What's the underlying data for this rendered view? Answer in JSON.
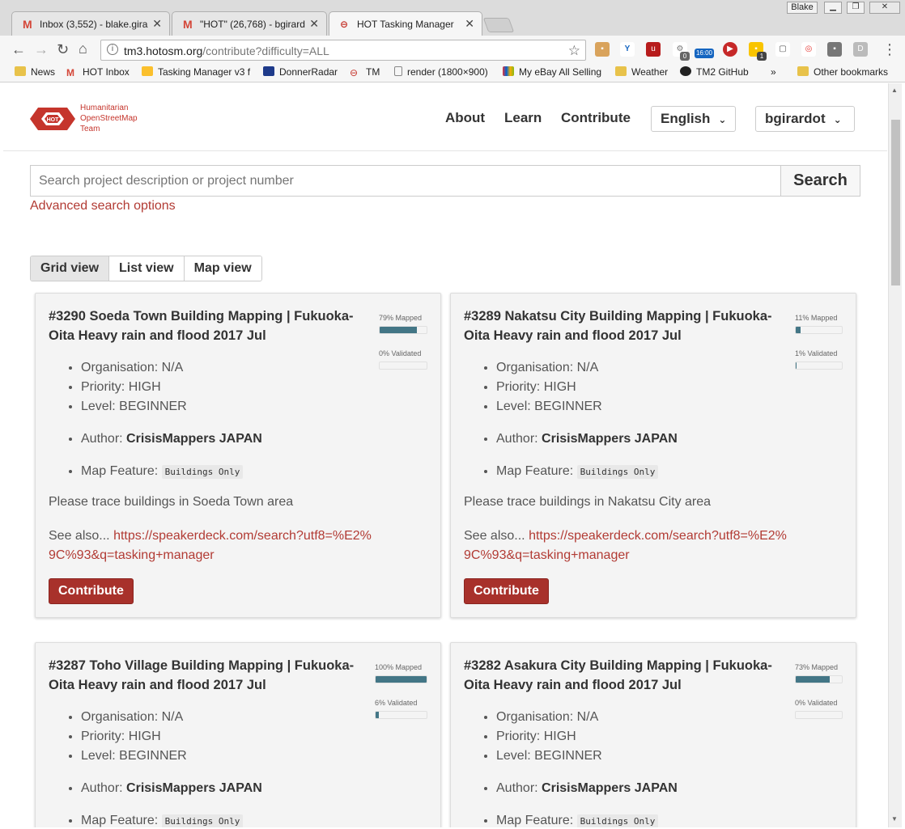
{
  "browser": {
    "window_user": "Blake",
    "tabs": [
      {
        "title": "Inbox (3,552) - blake.gira",
        "icon": "gmail-icon"
      },
      {
        "title": "\"HOT\" (26,768) - bgirard",
        "icon": "gmail-icon"
      },
      {
        "title": "HOT Tasking Manager",
        "icon": "hot-icon"
      }
    ],
    "url_host": "tm3.hotosm.org",
    "url_path": "/contribute?difficulty=ALL",
    "ext_badges": {
      "time": "16:00",
      "count0": "0",
      "count1": "1",
      "d": "D"
    },
    "bookmarks": [
      "News",
      "HOT Inbox",
      "Tasking Manager v3 f",
      "DonnerRadar",
      "TM",
      "render (1800×900)",
      "My eBay All Selling",
      "Weather",
      "TM2 GitHub"
    ],
    "bookmarks_more": "»",
    "other_bookmarks": "Other bookmarks"
  },
  "header": {
    "logo_lines": [
      "Humanitarian",
      "OpenStreetMap",
      "Team"
    ],
    "logo_badge": "HOT",
    "nav": [
      "About",
      "Learn",
      "Contribute"
    ],
    "language": "English",
    "user": "bgirardot"
  },
  "search": {
    "placeholder": "Search project description or project number",
    "button": "Search",
    "advanced": "Advanced search options"
  },
  "views": [
    "Grid view",
    "List view",
    "Map view"
  ],
  "projects": [
    {
      "title": "#3290 Soeda Town Building Mapping | Fukuoka-Oita Heavy rain and flood 2017 Jul",
      "mapped_label": "79% Mapped",
      "mapped": 0.79,
      "validated_label": "0% Validated",
      "validated": 0.0,
      "org_label": "Organisation:",
      "organisation": "N/A",
      "priority_label": "Priority:",
      "priority": "HIGH",
      "level_label": "Level:",
      "level": "BEGINNER",
      "author_label": "Author:",
      "author": "CrisisMappers JAPAN",
      "feature_label": "Map Feature:",
      "feature": "Buildings Only",
      "description": "Please trace buildings in Soeda Town area",
      "see_also": "See also...",
      "link": "https://speakerdeck.com/search?utf8=%E2%9C%93&q=tasking+manager",
      "button": "Contribute"
    },
    {
      "title": "#3289 Nakatsu City Building Mapping | Fukuoka-Oita Heavy rain and flood 2017 Jul",
      "mapped_label": "11% Mapped",
      "mapped": 0.11,
      "validated_label": "1% Validated",
      "validated": 0.01,
      "org_label": "Organisation:",
      "organisation": "N/A",
      "priority_label": "Priority:",
      "priority": "HIGH",
      "level_label": "Level:",
      "level": "BEGINNER",
      "author_label": "Author:",
      "author": "CrisisMappers JAPAN",
      "feature_label": "Map Feature:",
      "feature": "Buildings Only",
      "description": "Please trace buildings in Nakatsu City area",
      "see_also": "See also...",
      "link": "https://speakerdeck.com/search?utf8=%E2%9C%93&q=tasking+manager",
      "button": "Contribute"
    },
    {
      "title": "#3287 Toho Village Building Mapping | Fukuoka-Oita Heavy rain and flood 2017 Jul",
      "mapped_label": "100% Mapped",
      "mapped": 1.0,
      "validated_label": "6% Validated",
      "validated": 0.06,
      "org_label": "Organisation:",
      "organisation": "N/A",
      "priority_label": "Priority:",
      "priority": "HIGH",
      "level_label": "Level:",
      "level": "BEGINNER",
      "author_label": "Author:",
      "author": "CrisisMappers JAPAN",
      "feature_label": "Map Feature:",
      "feature": "Buildings Only"
    },
    {
      "title": "#3282 Asakura City Building Mapping | Fukuoka-Oita Heavy rain and flood 2017 Jul",
      "mapped_label": "73% Mapped",
      "mapped": 0.73,
      "validated_label": "0% Validated",
      "validated": 0.0,
      "org_label": "Organisation:",
      "organisation": "N/A",
      "priority_label": "Priority:",
      "priority": "HIGH",
      "level_label": "Level:",
      "level": "BEGINNER",
      "author_label": "Author:",
      "author": "CrisisMappers JAPAN",
      "feature_label": "Map Feature:",
      "feature": "Buildings Only"
    }
  ],
  "colors": {
    "brand": "#c5352c",
    "button": "#a8312b",
    "progress": "#437686",
    "link": "#b23b34"
  }
}
